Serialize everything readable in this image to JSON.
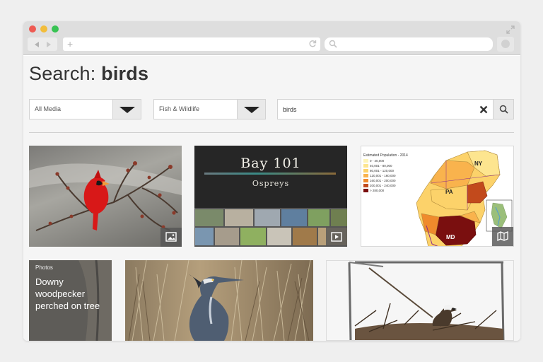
{
  "search": {
    "heading_prefix": "Search:",
    "heading_term": "birds",
    "media_filter": "All Media",
    "topic_filter": "Fish & Wildlife",
    "query_value": "birds"
  },
  "results": [
    {
      "kind": "image",
      "subject": "Northern cardinal perched on budding branch",
      "badge_icon": "image-icon"
    },
    {
      "kind": "video",
      "title": "Bay 101",
      "subtitle": "Ospreys",
      "badge_icon": "play-icon"
    },
    {
      "kind": "map",
      "legend_title": "Estimated Population - 2014",
      "legend": [
        "0 - 40,000",
        "40,001 - 80,000",
        "80,001 - 120,000",
        "120,001 - 160,000",
        "160,001 - 200,000",
        "200,001 - 240,000",
        "> 280,000"
      ],
      "legend_colors": [
        "#fdf4b8",
        "#fde58f",
        "#fcd26a",
        "#f9b34d",
        "#ef8a2c",
        "#c24a1c",
        "#7a0f0f"
      ],
      "states": [
        "NY",
        "PA",
        "MD"
      ],
      "badge_icon": "map-icon"
    },
    {
      "kind": "photo-set",
      "type_label": "Photos",
      "caption": "Downy woodpecker perched on tree"
    },
    {
      "kind": "image",
      "subject": "Great blue heron in marsh grass"
    },
    {
      "kind": "image",
      "subject": "Osprey on nest atop a platform"
    }
  ],
  "colors": {
    "accent_dark": "#222222",
    "background": "#f5f5f5",
    "chrome": "#dedede"
  }
}
